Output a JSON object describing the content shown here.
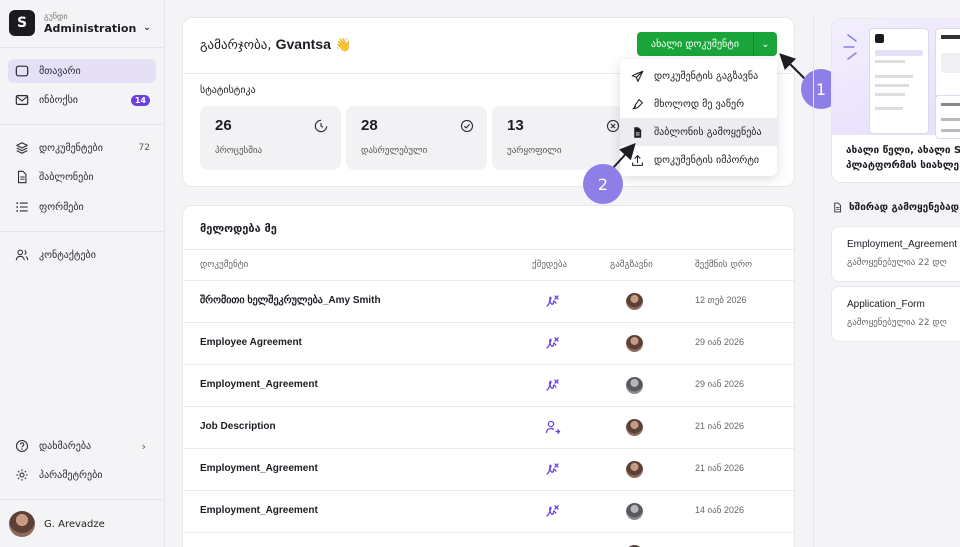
{
  "workspace": {
    "label": "გუნდი",
    "name": "Administration"
  },
  "sidebar": {
    "items": [
      {
        "label": "მთავარი"
      },
      {
        "label": "ინბოქსი",
        "badge": "14"
      },
      {
        "label": "დოკუმენტები",
        "count": "72"
      },
      {
        "label": "შაბლონები"
      },
      {
        "label": "ფორმები"
      },
      {
        "label": "კონტაქტები"
      }
    ],
    "bottom": [
      {
        "label": "დახმარება"
      },
      {
        "label": "პარამეტრები"
      }
    ],
    "user": "G. Arevadze"
  },
  "header": {
    "greeting": "გამარჯობა,",
    "name": "Gvantsa",
    "emoji": "👋",
    "new_doc_label": "ახალი დოკუმენტი"
  },
  "stats": {
    "title": "სტატისტიკა",
    "cards": [
      {
        "value": "26",
        "label": "პროცესშია"
      },
      {
        "value": "28",
        "label": "დასრულებული"
      },
      {
        "value": "13",
        "label": "უარყოფილი"
      }
    ]
  },
  "dropdown": {
    "items": [
      {
        "label": "დოკუმენტის გაგზავნა"
      },
      {
        "label": "მხოლოდ მე ვაწერ"
      },
      {
        "label": "შაბლონის გამოყენება"
      },
      {
        "label": "დოკუმენტის იმპორტი"
      }
    ]
  },
  "callouts": [
    "1",
    "2"
  ],
  "waiting": {
    "title": "მელოდება მე",
    "headers": [
      "დოკუმენტი",
      "ქმედება",
      "გამგზავნი",
      "შექმნის დრო"
    ],
    "rows": [
      {
        "doc": "შრომითი ხელშეკრულება_Amy Smith",
        "action": "sign",
        "date": "12 თებ 2026"
      },
      {
        "doc": "Employee Agreement",
        "action": "sign",
        "date": "29 იან 2026"
      },
      {
        "doc": "Employment_Agreement",
        "action": "sign",
        "date": "29 იან 2026"
      },
      {
        "doc": "Job Description",
        "action": "assign",
        "date": "21 იან 2026"
      },
      {
        "doc": "Employment_Agreement",
        "action": "sign",
        "date": "21 იან 2026"
      },
      {
        "doc": "Employment_Agreement",
        "action": "sign",
        "date": "14 იან 2026"
      }
    ]
  },
  "promo": {
    "line1": "ახალი წელი, ახალი Si",
    "line2": "პლატფორმის სიახლე"
  },
  "frequent": {
    "title": "ხშირად გამოყენებად",
    "items": [
      {
        "name": "Employment_Agreement",
        "sub": "გამოყენებულია 22 დღ"
      },
      {
        "name": "Application_Form",
        "sub": "გამოყენებულია 22 დღ"
      }
    ]
  },
  "colors": {
    "accent": "#6d3fe0",
    "green": "#1aa53a",
    "callout": "#8e7ee8",
    "active_nav": "#e6e0f6"
  }
}
